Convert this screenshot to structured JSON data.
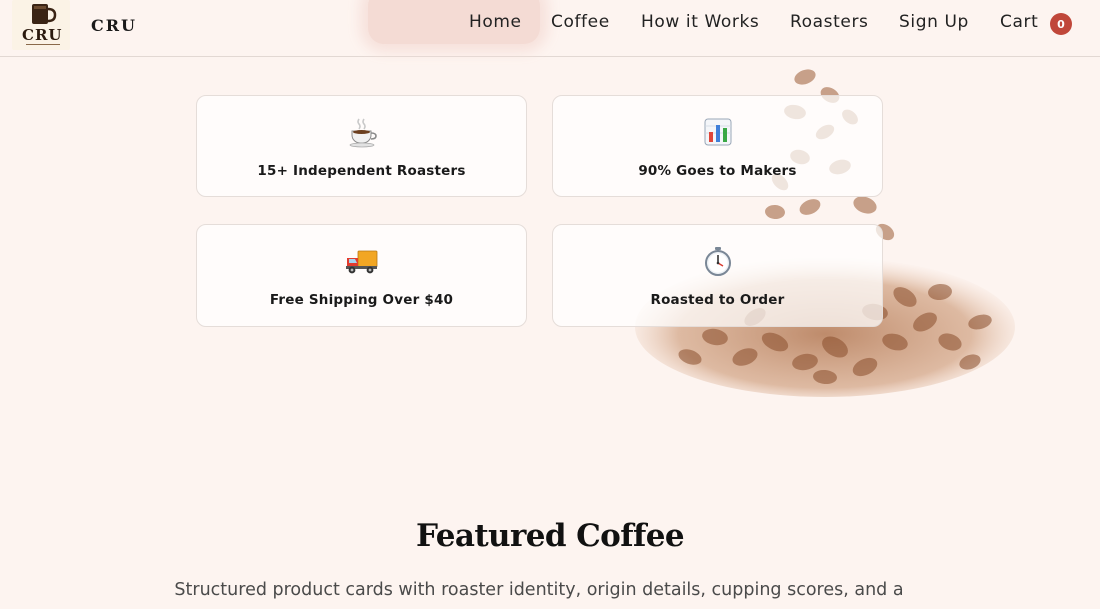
{
  "header": {
    "logo_text": "CRU",
    "brand": "CRU",
    "nav": [
      {
        "label": "Home"
      },
      {
        "label": "Coffee"
      },
      {
        "label": "How it Works"
      },
      {
        "label": "Roasters"
      },
      {
        "label": "Sign Up"
      },
      {
        "label": "Cart"
      }
    ],
    "cart_count": "0"
  },
  "stats": [
    {
      "icon": "coffee-cup-icon",
      "label": "15+ Independent Roasters"
    },
    {
      "icon": "bar-chart-icon",
      "label": "90% Goes to Makers"
    },
    {
      "icon": "delivery-truck-icon",
      "label": "Free Shipping Over $40"
    },
    {
      "icon": "stopwatch-icon",
      "label": "Roasted to Order"
    }
  ],
  "featured": {
    "title": "Featured Coffee",
    "subtitle": "Structured product cards with roaster identity, origin details, cupping scores, and a"
  },
  "colors": {
    "page_bg": "#fdf4f0",
    "cart_badge": "#c0473a",
    "text": "#1a1a1a"
  }
}
